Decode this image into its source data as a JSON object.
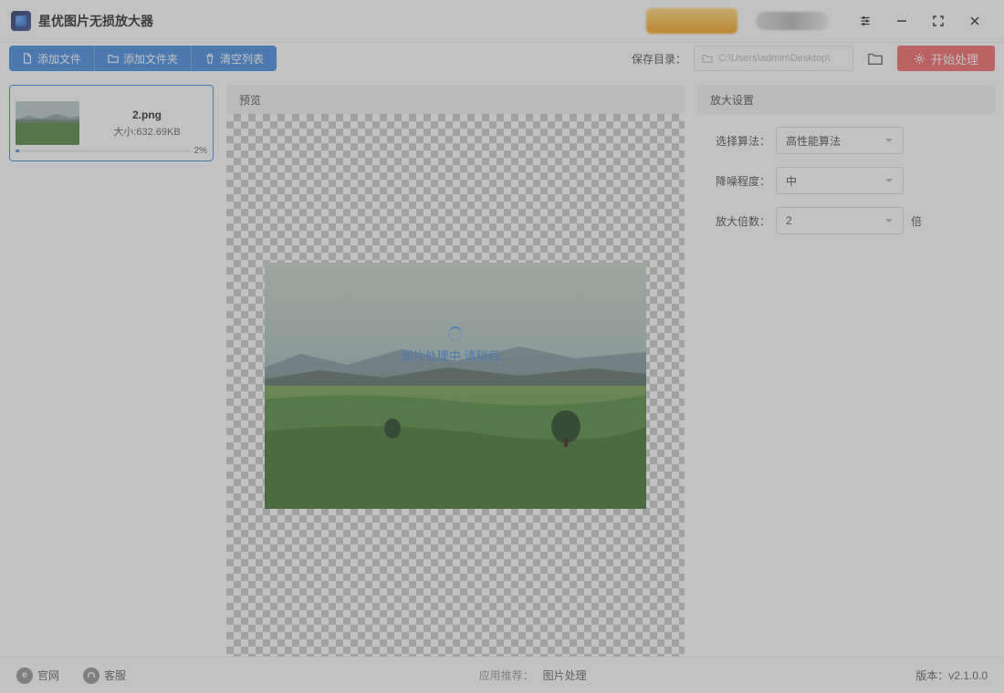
{
  "app": {
    "title": "星优图片无损放大器"
  },
  "toolbar": {
    "add_file": "添加文件",
    "add_folder": "添加文件夹",
    "clear_list": "清空列表",
    "save_dir_label": "保存目录：",
    "save_path": "C:\\Users\\admin\\Desktop\\",
    "start": "开始处理"
  },
  "file": {
    "name": "2.png",
    "size_label": "大小:632.69KB",
    "progress_pct": "2%"
  },
  "preview": {
    "title": "预览",
    "loading_text": "图片处理中,请稍后..."
  },
  "settings": {
    "title": "放大设置",
    "algo_label": "选择算法：",
    "algo_value": "高性能算法",
    "denoise_label": "降噪程度：",
    "denoise_value": "中",
    "scale_label": "放大倍数：",
    "scale_value": "2",
    "scale_unit": "倍"
  },
  "footer": {
    "official": "官网",
    "support": "客服",
    "rec_label": "应用推荐：",
    "rec_link": "图片处理",
    "version_label": "版本：",
    "version": "v2.1.0.0"
  }
}
